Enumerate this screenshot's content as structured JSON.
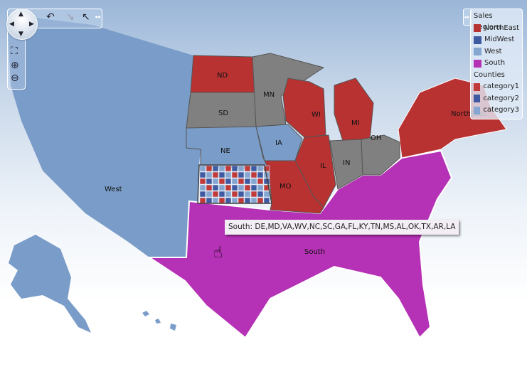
{
  "colors": {
    "west": "#7a9cc8",
    "northeast": "#b83232",
    "midwest_gray": "#808080",
    "south": "#b531b5",
    "category1": "#c03a3a",
    "category2": "#3f5aa0",
    "category3": "#84a6d0"
  },
  "map": {
    "regions": [
      {
        "id": "west",
        "label": "West",
        "region": "West"
      },
      {
        "id": "south",
        "label": "South",
        "region": "South"
      },
      {
        "id": "northeast",
        "label": "NorthEast",
        "region": "NorthEast"
      }
    ],
    "states": [
      {
        "abbr": "ND",
        "region": "NorthEast"
      },
      {
        "abbr": "SD",
        "region": "MidWest"
      },
      {
        "abbr": "NE",
        "region": "West"
      },
      {
        "abbr": "MN",
        "region": "MidWest"
      },
      {
        "abbr": "IA",
        "region": "West"
      },
      {
        "abbr": "WI",
        "region": "NorthEast"
      },
      {
        "abbr": "MI",
        "region": "NorthEast"
      },
      {
        "abbr": "IL",
        "region": "NorthEast"
      },
      {
        "abbr": "IN",
        "region": "MidWest"
      },
      {
        "abbr": "OH",
        "region": "MidWest"
      },
      {
        "abbr": "MO",
        "region": "NorthEast"
      }
    ]
  },
  "tooltip": {
    "text": "South: DE,MD,VA,WV,NC,SC,GA,FL,KY,TN,MS,AL,OK,TX,AR,LA"
  },
  "legend": {
    "toggle_icon": "double-chevron-right",
    "sales_title": "Sales Regions",
    "sales_items": [
      {
        "label": "NorthEast",
        "color": "#b83232"
      },
      {
        "label": "MidWest",
        "color": "#3f5aa0"
      },
      {
        "label": "West",
        "color": "#84a6d0"
      },
      {
        "label": "South",
        "color": "#b531b5"
      }
    ],
    "counties_title": "Counties",
    "county_items": [
      {
        "label": "category1",
        "color": "#c03a3a"
      },
      {
        "label": "category2",
        "color": "#3f5aa0"
      },
      {
        "label": "category3",
        "color": "#84a6d0"
      }
    ]
  },
  "toolbar": {
    "icons": [
      "undo",
      "redo",
      "select-arrow",
      "collapse"
    ],
    "zoom_icons": [
      "zoom-to-fit",
      "zoom-in",
      "zoom-out"
    ]
  }
}
